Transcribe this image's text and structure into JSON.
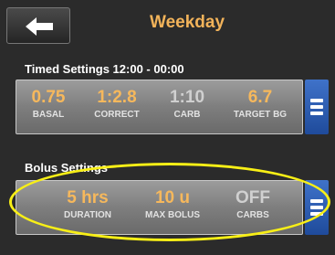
{
  "header": {
    "title": "Weekday"
  },
  "timed": {
    "label": "Timed Settings 12:00 - 00:00",
    "items": [
      {
        "value": "0.75",
        "label": "BASAL"
      },
      {
        "value": "1:2.8",
        "label": "CORRECT"
      },
      {
        "value": "1:10",
        "label": "CARB"
      },
      {
        "value": "6.7",
        "label": "TARGET BG"
      }
    ]
  },
  "bolus": {
    "label": "Bolus Settings",
    "items": [
      {
        "value": "5 hrs",
        "label": "DURATION"
      },
      {
        "value": "10 u",
        "label": "MAX BOLUS"
      },
      {
        "value": "OFF",
        "label": "CARBS"
      }
    ]
  },
  "colors": {
    "accent": "#f6b85c",
    "muted": "#d0d0d0",
    "highlight": "#f8ef16",
    "menu": "#2f5fb3"
  },
  "icons": {
    "back": "arrow-left-icon",
    "menu": "hamburger-menu-icon"
  }
}
